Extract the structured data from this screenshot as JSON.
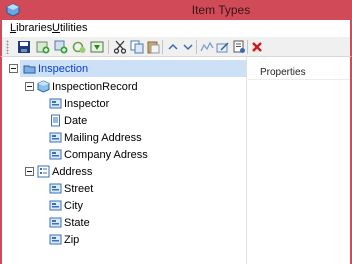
{
  "window": {
    "title": "Item Types"
  },
  "menu": [
    {
      "label_pre": "",
      "label_ul": "L",
      "label_post": "ibraries"
    },
    {
      "label_pre": "",
      "label_ul": "U",
      "label_post": "tilities"
    }
  ],
  "toolbar": {
    "buttons": [
      "save-icon",
      "add-icon",
      "add-child-icon",
      "refresh-icon",
      "import-icon",
      "cut-icon",
      "copy-icon",
      "paste-icon",
      "move-up-icon",
      "move-down-icon",
      "rename-icon",
      "edit-icon",
      "properties-icon",
      "delete-icon"
    ]
  },
  "tree": {
    "root": {
      "label": "Inspection",
      "selected": true
    },
    "inspection_record": {
      "label": "InspectionRecord",
      "fields": [
        "Inspector",
        "Date",
        "Mailing Address",
        "Company Adress"
      ]
    },
    "address": {
      "label": "Address",
      "fields": [
        "Street",
        "City",
        "State",
        "Zip"
      ]
    }
  },
  "properties_panel": {
    "label": "Properties"
  },
  "colors": {
    "titlebar": "#d04a58",
    "selection": "#cce0f6",
    "root_text": "#0a3fd0"
  }
}
